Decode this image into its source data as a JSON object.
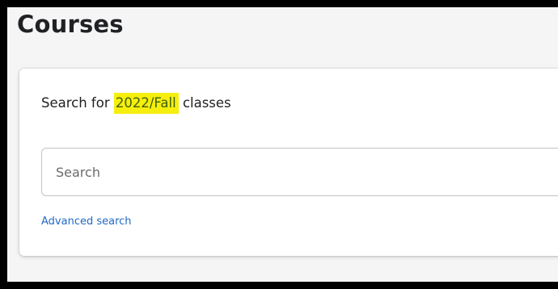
{
  "page": {
    "title": "Courses"
  },
  "search": {
    "prompt_prefix": "Search for",
    "term": "2022/Fall",
    "prompt_suffix": "classes",
    "placeholder": "Search",
    "value": "",
    "advanced_link": "Advanced search"
  },
  "colors": {
    "highlight_bg": "#f6ee0d",
    "highlight_text": "#3f6112",
    "link": "#1f69c7"
  }
}
